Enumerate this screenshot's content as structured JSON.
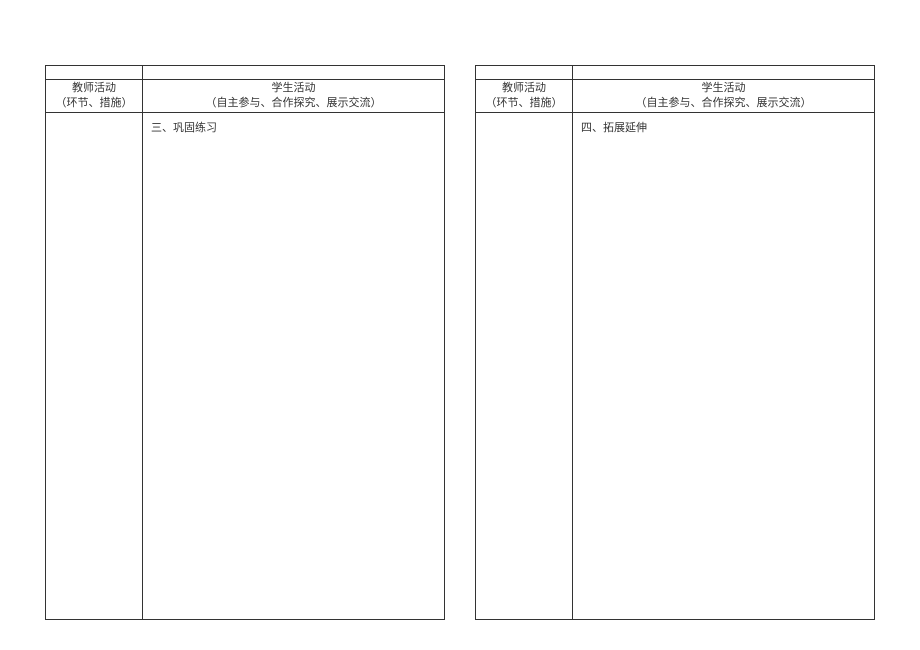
{
  "left_page": {
    "header_left_line1": "教师活动",
    "header_left_line2": "（环节、措施）",
    "header_right_line1": "学生活动",
    "header_right_line2": "（自主参与、合作探究、展示交流）",
    "body_right_content": "三、巩固练习"
  },
  "right_page": {
    "header_left_line1": "教师活动",
    "header_left_line2": "（环节、措施）",
    "header_right_line1": "学生活动",
    "header_right_line2": "（自主参与、合作探究、展示交流）",
    "body_right_content": "四、拓展延伸"
  }
}
